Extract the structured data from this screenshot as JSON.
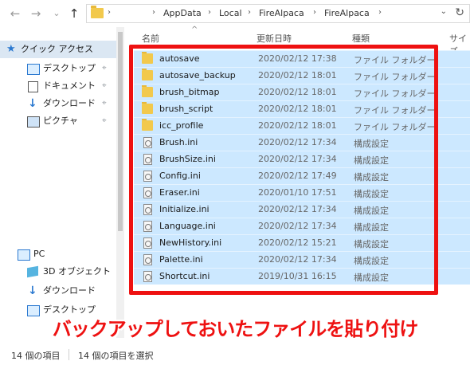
{
  "nav": {
    "back": "←",
    "forward": "→",
    "recent": "⌄",
    "up": "↑"
  },
  "address": {
    "path": [
      "AppData",
      "Local",
      "FireAlpaca",
      "FireAlpaca"
    ],
    "sep": "›",
    "dropdown": "⌄",
    "refresh": "↻"
  },
  "sidebar": {
    "quick_access": "クイック アクセス",
    "items": [
      {
        "label": "デスクトップ",
        "pinned": "📌"
      },
      {
        "label": "ドキュメント",
        "pinned": "📌"
      },
      {
        "label": "ダウンロード",
        "pinned": "📌"
      },
      {
        "label": "ピクチャ",
        "pinned": "📌"
      }
    ],
    "pc": "PC",
    "pc_items": [
      {
        "label": "3D オブジェクト"
      },
      {
        "label": "ダウンロード"
      },
      {
        "label": "デスクトップ"
      }
    ]
  },
  "columns": {
    "name": "名前",
    "date": "更新日時",
    "type": "種類",
    "size": "サイズ",
    "sort_indicator": "^"
  },
  "files": [
    {
      "name": "autosave",
      "date": "2020/02/12 17:38",
      "type": "ファイル フォルダー",
      "kind": "folder"
    },
    {
      "name": "autosave_backup",
      "date": "2020/02/12 18:01",
      "type": "ファイル フォルダー",
      "kind": "folder"
    },
    {
      "name": "brush_bitmap",
      "date": "2020/02/12 18:01",
      "type": "ファイル フォルダー",
      "kind": "folder"
    },
    {
      "name": "brush_script",
      "date": "2020/02/12 18:01",
      "type": "ファイル フォルダー",
      "kind": "folder"
    },
    {
      "name": "icc_profile",
      "date": "2020/02/12 18:01",
      "type": "ファイル フォルダー",
      "kind": "folder"
    },
    {
      "name": "Brush.ini",
      "date": "2020/02/12 17:34",
      "type": "構成設定",
      "kind": "ini"
    },
    {
      "name": "BrushSize.ini",
      "date": "2020/02/12 17:34",
      "type": "構成設定",
      "kind": "ini"
    },
    {
      "name": "Config.ini",
      "date": "2020/02/12 17:49",
      "type": "構成設定",
      "kind": "ini"
    },
    {
      "name": "Eraser.ini",
      "date": "2020/01/10 17:51",
      "type": "構成設定",
      "kind": "ini"
    },
    {
      "name": "Initialize.ini",
      "date": "2020/02/12 17:34",
      "type": "構成設定",
      "kind": "ini"
    },
    {
      "name": "Language.ini",
      "date": "2020/02/12 17:34",
      "type": "構成設定",
      "kind": "ini"
    },
    {
      "name": "NewHistory.ini",
      "date": "2020/02/12 15:21",
      "type": "構成設定",
      "kind": "ini"
    },
    {
      "name": "Palette.ini",
      "date": "2020/02/12 17:34",
      "type": "構成設定",
      "kind": "ini"
    },
    {
      "name": "Shortcut.ini",
      "date": "2019/10/31 16:15",
      "type": "構成設定",
      "kind": "ini"
    }
  ],
  "caption": "バックアップしておいたファイルを貼り付け",
  "status": {
    "count": "14 個の項目",
    "selected": "14 個の項目を選択"
  },
  "colors": {
    "selection": "#cce8ff",
    "highlight": "#ee1111",
    "folder": "#f2c94c"
  }
}
